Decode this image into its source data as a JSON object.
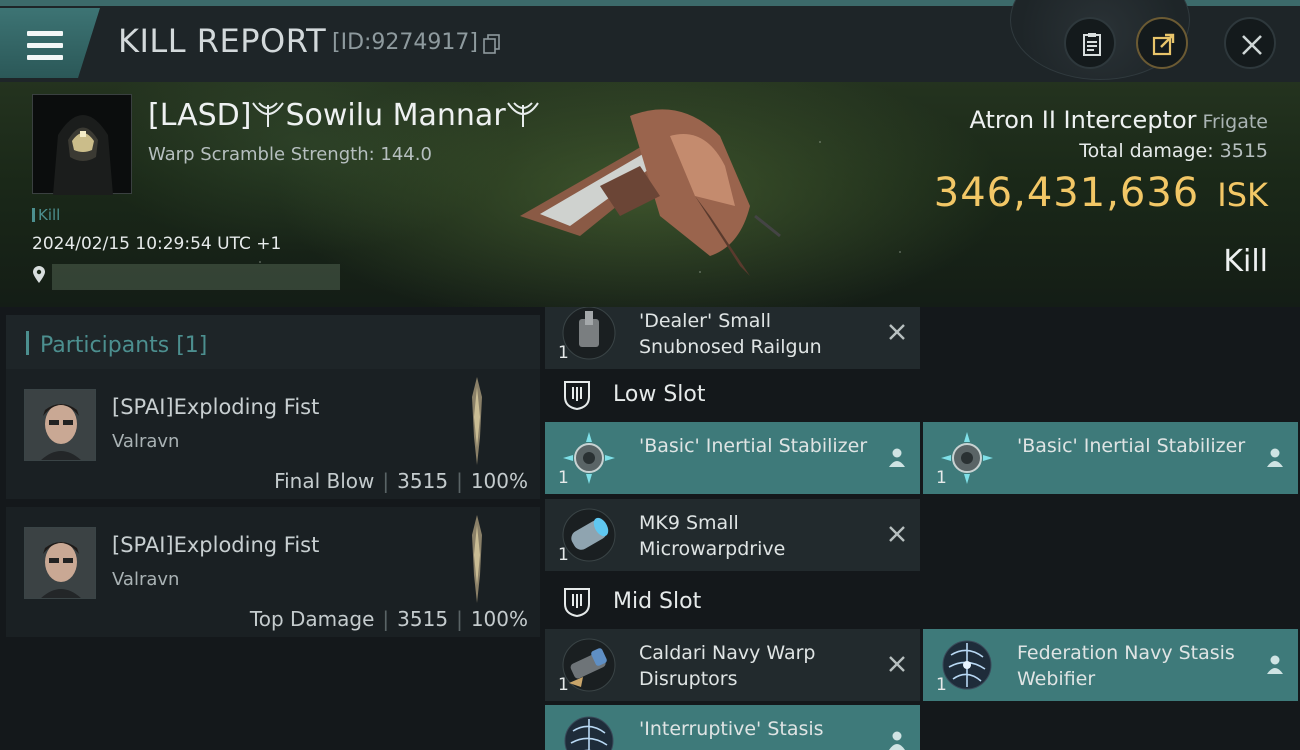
{
  "header": {
    "title": "KILL REPORT",
    "report_id": "[ID:9274917]"
  },
  "victim": {
    "name_prefix": "[LASD]",
    "name": "Sowilu Mannar",
    "warp_scramble": "Warp Scramble Strength: 144.0",
    "kill_tag": "Kill",
    "date": "2024/02/15 10:29:54 UTC +1"
  },
  "ship": {
    "name": "Atron II Interceptor",
    "class": "Frigate",
    "total_damage_label": "Total damage:",
    "total_damage": "3515",
    "isk_amount": "346,431,636",
    "isk_unit": "ISK",
    "result": "Kill"
  },
  "participants": {
    "title": "Participants [1]",
    "rows": [
      {
        "name": "[SPAI]Exploding Fist",
        "ship": "Valravn",
        "role": "Final Blow",
        "damage": "3515",
        "percent": "100%"
      },
      {
        "name": "[SPAI]Exploding Fist",
        "ship": "Valravn",
        "role": "Top Damage",
        "damage": "3515",
        "percent": "100%"
      }
    ]
  },
  "fitting": {
    "modules": [
      {
        "name": "'Dealer' Small Snubnosed Railgun",
        "qty": "1"
      },
      {
        "name": "'Basic' Inertial Stabilizer",
        "qty": "1"
      },
      {
        "name": "'Basic' Inertial Stabilizer",
        "qty": "1"
      },
      {
        "name": "MK9 Small Microwarpdrive",
        "qty": "1"
      },
      {
        "name": "Caldari Navy Warp Disruptors",
        "qty": "1"
      },
      {
        "name": "Federation Navy Stasis Webifier",
        "qty": "1"
      },
      {
        "name": "'Interruptive' Stasis",
        "qty": ""
      }
    ],
    "low_slot_title": "Low Slot",
    "mid_slot_title": "Mid Slot"
  },
  "colors": {
    "accent_teal": "#3e7a7a",
    "isk_gold": "#f2c766",
    "panel": "#222a2d"
  },
  "icons": [
    "menu-icon",
    "copy-icon",
    "clipboard-icon",
    "share-icon",
    "close-icon",
    "location-pin-icon",
    "person-icon",
    "x-icon",
    "slot-icon"
  ]
}
